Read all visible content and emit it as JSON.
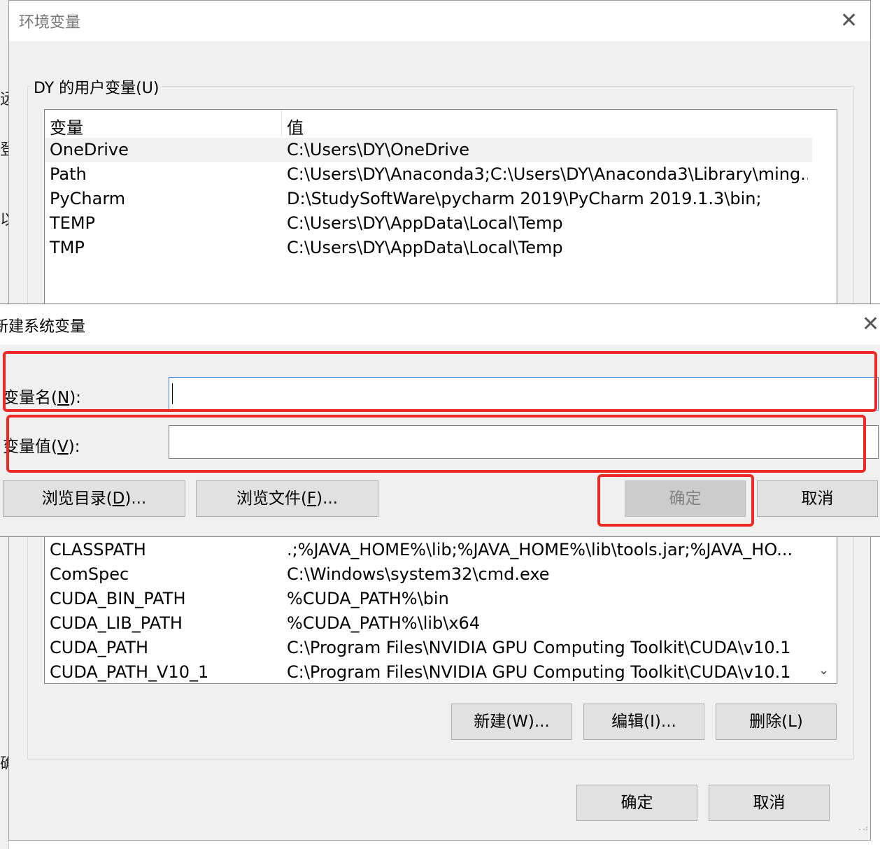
{
  "background_window": {
    "glyphs": [
      "远",
      "登",
      "以",
      "确"
    ]
  },
  "env_dialog": {
    "title": "环境变量",
    "close_icon": "close-icon",
    "user_group_label": "DY 的用户变量(U)",
    "user_columns": [
      "变量",
      "值"
    ],
    "user_rows": [
      {
        "name": "OneDrive",
        "value": "C:\\Users\\DY\\OneDrive",
        "selected": true
      },
      {
        "name": "Path",
        "value": "C:\\Users\\DY\\Anaconda3;C:\\Users\\DY\\Anaconda3\\Library\\ming..."
      },
      {
        "name": "PyCharm",
        "value": "D:\\StudySoftWare\\pycharm 2019\\PyCharm 2019.1.3\\bin;"
      },
      {
        "name": "TEMP",
        "value": "C:\\Users\\DY\\AppData\\Local\\Temp"
      },
      {
        "name": "TMP",
        "value": "C:\\Users\\DY\\AppData\\Local\\Temp"
      }
    ],
    "system_rows": [
      {
        "name": "CLASSPATH",
        "value": ".;%JAVA_HOME%\\lib;%JAVA_HOME%\\lib\\tools.jar;%JAVA_HO..."
      },
      {
        "name": "ComSpec",
        "value": "C:\\Windows\\system32\\cmd.exe"
      },
      {
        "name": "CUDA_BIN_PATH",
        "value": "%CUDA_PATH%\\bin"
      },
      {
        "name": "CUDA_LIB_PATH",
        "value": "%CUDA_PATH%\\lib\\x64"
      },
      {
        "name": "CUDA_PATH",
        "value": "C:\\Program Files\\NVIDIA GPU Computing Toolkit\\CUDA\\v10.1"
      },
      {
        "name": "CUDA_PATH_V10_1",
        "value": "C:\\Program Files\\NVIDIA GPU Computing Toolkit\\CUDA\\v10.1"
      }
    ],
    "system_buttons": {
      "new": "新建(W)...",
      "edit": "编辑(I)...",
      "delete": "删除(L)"
    },
    "ok": "确定",
    "cancel": "取消"
  },
  "new_dialog": {
    "title": "新建系统变量",
    "name_label_prefix": "变量名(",
    "name_label_key": "N",
    "name_label_suffix": "):",
    "value_label_prefix": "变量值(",
    "value_label_key": "V",
    "value_label_suffix": "):",
    "name_value": "",
    "value_value": "",
    "browse_dir_prefix": "浏览目录(",
    "browse_dir_key": "D",
    "browse_dir_suffix": ")...",
    "browse_file_prefix": "浏览文件(",
    "browse_file_key": "F",
    "browse_file_suffix": ")...",
    "ok": "确定",
    "cancel": "取消",
    "ok_disabled": true
  },
  "annotation_color": "#ec2a24"
}
